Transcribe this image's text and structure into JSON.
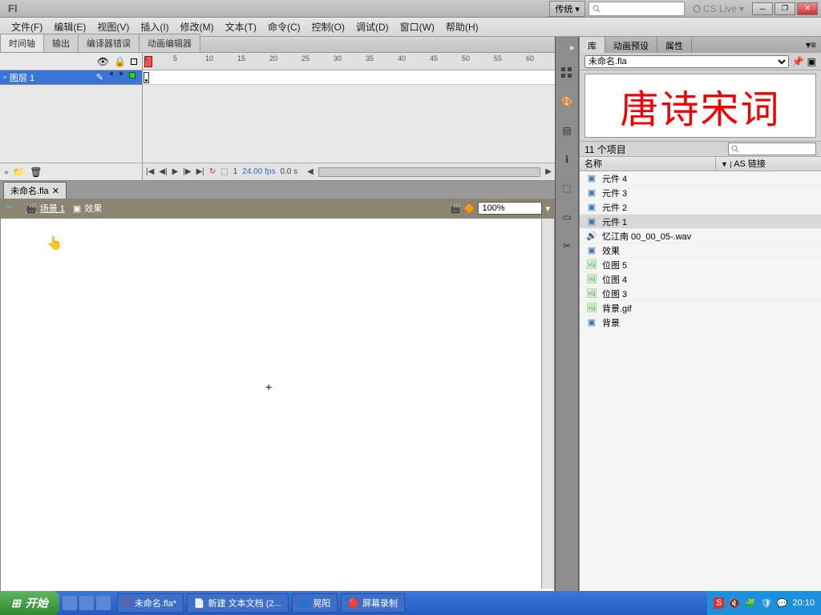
{
  "app_logo": "Fl",
  "workspace_menu": "传统 ▾",
  "cs_live": "CS Live",
  "menu": [
    "文件(F)",
    "编辑(E)",
    "视图(V)",
    "插入(I)",
    "修改(M)",
    "文本(T)",
    "命令(C)",
    "控制(O)",
    "调试(D)",
    "窗口(W)",
    "帮助(H)"
  ],
  "timeline_tabs": [
    "时间轴",
    "输出",
    "编译器错误",
    "动画编辑器"
  ],
  "ruler_marks": [
    "1",
    "5",
    "10",
    "15",
    "20",
    "25",
    "30",
    "35",
    "40",
    "45",
    "50",
    "55",
    "60"
  ],
  "layer_name": "图层 1",
  "frame_num": "1",
  "fps": "24.00 fps",
  "elapsed": "0.0 s",
  "doc_tab": "未命名.fla",
  "scene_crumbs": [
    "场景 1",
    "效果"
  ],
  "zoom": "100%",
  "lib_tabs": [
    "库",
    "动画预设",
    "属性"
  ],
  "lib_doc": "未命名.fla",
  "preview_text": "唐诗宋词",
  "item_count": "11 个项目",
  "lib_cols": [
    "名称",
    "AS 链接"
  ],
  "lib_items": [
    {
      "name": "元件 4",
      "icon": "mc"
    },
    {
      "name": "元件 3",
      "icon": "mc"
    },
    {
      "name": "元件 2",
      "icon": "mc"
    },
    {
      "name": "元件 1",
      "icon": "mc",
      "sel": true
    },
    {
      "name": "忆江南 00_00_05-.wav",
      "icon": "snd"
    },
    {
      "name": "效果",
      "icon": "mc"
    },
    {
      "name": "位图 5",
      "icon": "bmp"
    },
    {
      "name": "位图 4",
      "icon": "bmp"
    },
    {
      "name": "位图 3",
      "icon": "bmp"
    },
    {
      "name": "背景.gif",
      "icon": "bmp"
    },
    {
      "name": "背景",
      "icon": "mc"
    }
  ],
  "taskbar": {
    "start": "开始",
    "items": [
      "未命名.fla*",
      "新建 文本文档 (2...",
      "晃阳",
      "屏幕录制"
    ],
    "time": "20:10"
  }
}
